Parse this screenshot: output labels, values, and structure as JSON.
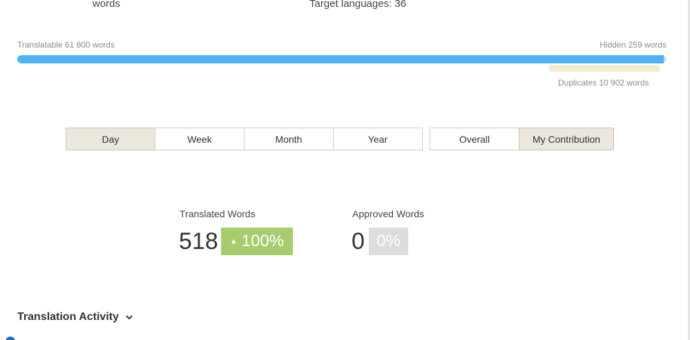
{
  "header": {
    "words_label": "words",
    "target_languages": "Target languages: 36"
  },
  "progress": {
    "translatable_label": "Translatable 61 800 words",
    "hidden_label": "Hidden 259 words",
    "duplicates_label": "Duplicates 10 902 words",
    "translatable_fraction": 0.996,
    "bar_color": "#4db3f6",
    "duplicates_color": "#f7ebcd"
  },
  "period_tabs": [
    {
      "label": "Day",
      "active": true
    },
    {
      "label": "Week",
      "active": false
    },
    {
      "label": "Month",
      "active": false
    },
    {
      "label": "Year",
      "active": false
    }
  ],
  "scope_tabs": [
    {
      "label": "Overall",
      "active": false
    },
    {
      "label": "My Contribution",
      "active": true
    }
  ],
  "stats": {
    "translated": {
      "label": "Translated Words",
      "value": "518",
      "change": "100%",
      "change_icon": "triangle-up-icon",
      "color": "#a7cc6e"
    },
    "approved": {
      "label": "Approved Words",
      "value": "0",
      "change": "0%",
      "color": "#dcdcdc"
    }
  },
  "section": {
    "title": "Translation Activity",
    "icon": "chevron-down-icon"
  }
}
